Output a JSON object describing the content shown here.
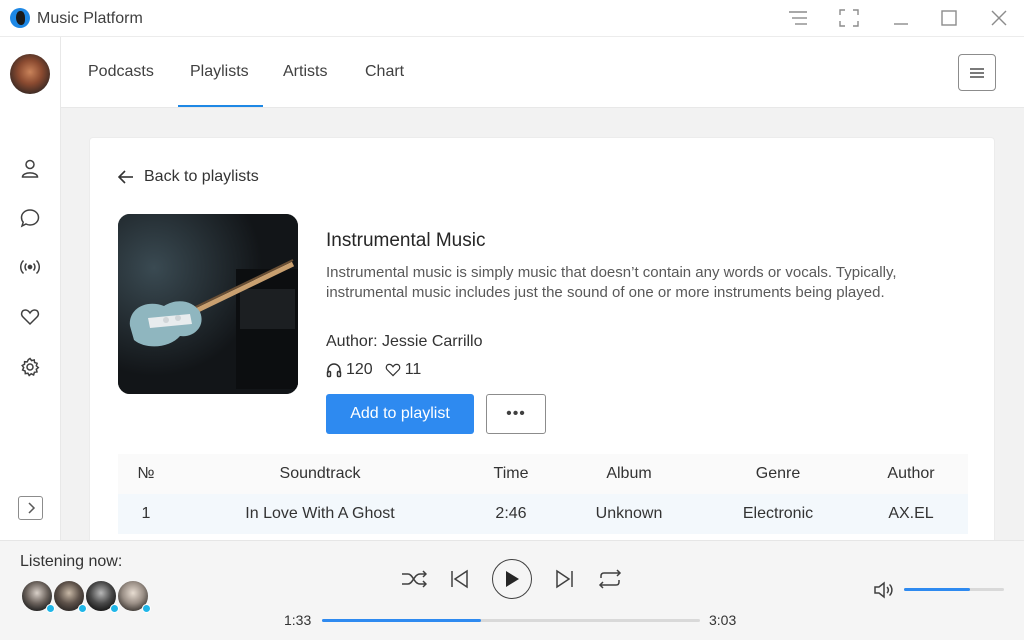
{
  "app": {
    "title": "Music Platform"
  },
  "nav": {
    "tabs": [
      {
        "label": "Podcasts"
      },
      {
        "label": "Playlists",
        "active": true
      },
      {
        "label": "Artists"
      },
      {
        "label": "Chart"
      }
    ]
  },
  "sidebar": {
    "icons": [
      "user-icon",
      "chat-icon",
      "broadcast-icon",
      "heart-icon",
      "settings-icon"
    ]
  },
  "playlist": {
    "back_label": "Back to playlists",
    "title": "Instrumental Music",
    "description": "Instrumental music is simply music that doesn’t contain any words or vocals. Typically, instrumental music includes just the sound of one or more instruments being played.",
    "author": "Author: Jessie Carrillo",
    "listens": "120",
    "likes": "11",
    "add_button": "Add to playlist",
    "more_button": "•••"
  },
  "table": {
    "headers": [
      "№",
      "Soundtrack",
      "Time",
      "Album",
      "Genre",
      "Author"
    ],
    "rows": [
      [
        "1",
        "In Love With A Ghost",
        "2:46",
        "Unknown",
        "Electronic",
        "AX.EL"
      ]
    ]
  },
  "player": {
    "listening_label": "Listening now:",
    "current_time": "1:33",
    "total_time": "3:03",
    "progress_fraction": 0.42,
    "volume_fraction": 0.66
  },
  "colors": {
    "accent": "#2e8af0",
    "status_online": "#1fb6e8"
  }
}
